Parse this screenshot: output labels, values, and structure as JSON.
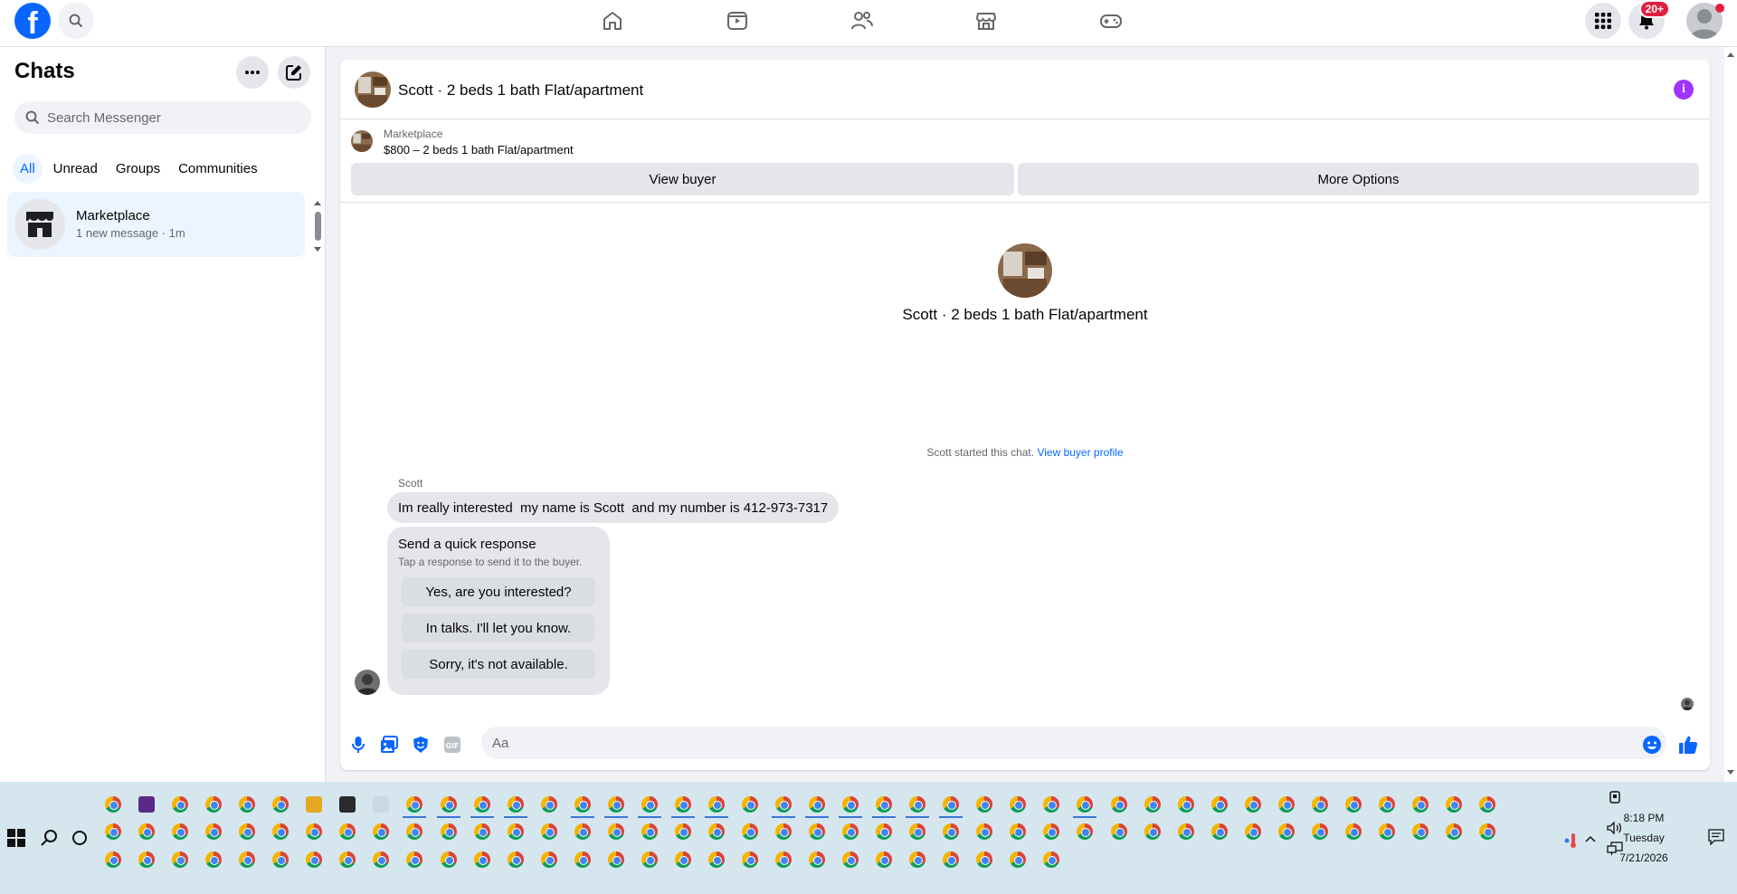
{
  "colors": {
    "brand": "#0866ff",
    "info": "#a033ff",
    "badge": "#e41e3f",
    "active_chat": "#ebf5ff"
  },
  "topbar": {
    "logo_letter": "f",
    "notifications_badge": "20+",
    "nav_icons": [
      "home-icon",
      "video-icon",
      "friends-icon",
      "marketplace-icon",
      "gaming-icon"
    ]
  },
  "sidebar": {
    "title": "Chats",
    "search_placeholder": "Search Messenger",
    "filters": [
      "All",
      "Unread",
      "Groups",
      "Communities"
    ],
    "chat": {
      "name": "Marketplace",
      "subtitle": "1 new message · 1m"
    }
  },
  "conversation": {
    "title": "Scott · 2 beds 1 bath Flat/apartment",
    "marketplace_label": "Marketplace",
    "listing": "$800 – 2 beds 1 bath Flat/apartment",
    "view_buyer": "View buyer",
    "more_options": "More Options",
    "center_name": "Scott · 2 beds 1 bath Flat/apartment",
    "started_text": "Scott started this chat.",
    "view_profile": "View buyer profile",
    "sender": "Scott",
    "message": "Im really interested  my name is Scott  and my number is 412-973-7317",
    "quick_title": "Send a quick response",
    "quick_sub": "Tap a response to send it to the buyer.",
    "quick_options": [
      "Yes, are you interested?",
      "In talks. I'll let you know.",
      "Sorry, it's not available."
    ],
    "composer_placeholder": "Aa"
  },
  "taskbar": {
    "time": "8:18 PM",
    "day": "Tuesday",
    "date": "7/21/2026"
  }
}
